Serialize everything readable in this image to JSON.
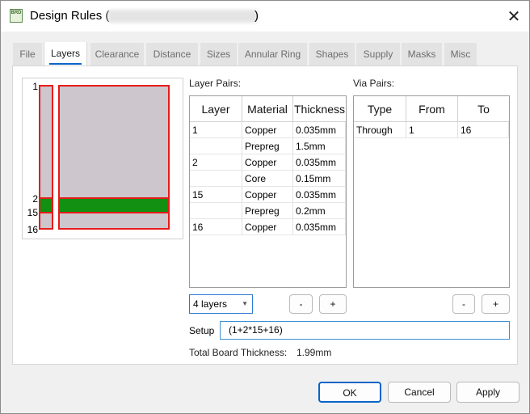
{
  "window": {
    "title": "Design Rules (",
    "title_close": ")",
    "icon_label": "BRD",
    "close_glyph": "✕"
  },
  "tabs": [
    {
      "label": "File",
      "active": false
    },
    {
      "label": "Layers",
      "active": true
    },
    {
      "label": "Clearance",
      "active": false
    },
    {
      "label": "Distance",
      "active": false
    },
    {
      "label": "Sizes",
      "active": false
    },
    {
      "label": "Annular Ring",
      "active": false
    },
    {
      "label": "Shapes",
      "active": false
    },
    {
      "label": "Supply",
      "active": false
    },
    {
      "label": "Masks",
      "active": false
    },
    {
      "label": "Misc",
      "active": false
    }
  ],
  "stackup": {
    "layer_numbers": [
      "1",
      "2",
      "15",
      "16"
    ]
  },
  "layer_pairs": {
    "label": "Layer Pairs:",
    "columns": [
      "Layer",
      "Material",
      "Thickness"
    ],
    "rows": [
      [
        "1",
        "Copper",
        "0.035mm"
      ],
      [
        "",
        "Prepreg",
        "1.5mm"
      ],
      [
        "2",
        "Copper",
        "0.035mm"
      ],
      [
        "",
        "Core",
        "0.15mm"
      ],
      [
        "15",
        "Copper",
        "0.035mm"
      ],
      [
        "",
        "Prepreg",
        "0.2mm"
      ],
      [
        "16",
        "Copper",
        "0.035mm"
      ]
    ]
  },
  "via_pairs": {
    "label": "Via Pairs:",
    "columns": [
      "Type",
      "From",
      "To"
    ],
    "rows": [
      [
        "Through",
        "1",
        "16"
      ]
    ]
  },
  "layers_select": {
    "value": "4 layers",
    "arrow": "▼"
  },
  "buttons": {
    "minus": "-",
    "plus": "+",
    "ok": "OK",
    "cancel": "Cancel",
    "apply": "Apply"
  },
  "setup": {
    "label": "Setup",
    "value": "(1+2*15+16)"
  },
  "total_thickness": {
    "label": "Total Board Thickness:",
    "value": "1.99mm"
  },
  "colors": {
    "accent": "#0a64c8",
    "copper_outline": "#e51b1b",
    "core_fill": "#129012",
    "dielectric_fill": "#cdc6cc"
  }
}
